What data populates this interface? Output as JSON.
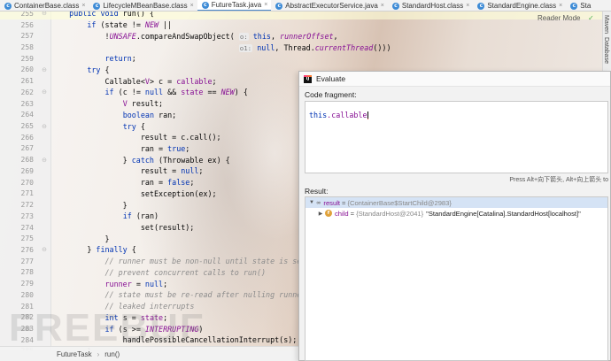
{
  "tabs": [
    {
      "label": "ContainerBase.class",
      "icon": "class-icon",
      "active": false
    },
    {
      "label": "LifecycleMBeanBase.class",
      "icon": "class-icon",
      "active": false
    },
    {
      "label": "FutureTask.java",
      "icon": "java-class-icon",
      "active": true
    },
    {
      "label": "AbstractExecutorService.java",
      "icon": "java-class-icon",
      "active": false
    },
    {
      "label": "StandardHost.class",
      "icon": "class-icon",
      "active": false
    },
    {
      "label": "StandardEngine.class",
      "icon": "class-icon",
      "active": false
    },
    {
      "label": "Sta",
      "icon": "class-icon",
      "active": false
    }
  ],
  "editor": {
    "reader_mode": "Reader Mode",
    "lines": [
      {
        "num": "255",
        "html": "    <span class=\"kw\">public void</span> run() {"
      },
      {
        "num": "256",
        "html": "        <span class=\"kw\">if</span> (state != <span class=\"it\">NEW</span> ||"
      },
      {
        "num": "257",
        "html": "            !<span class=\"it\">UNSAFE</span>.compareAndSwapObject( <span class=\"hint\">o:</span> <span class=\"kw\">this</span>, <span class=\"it\">runnerOffset</span>,"
      },
      {
        "num": "258",
        "html": "                                          <span class=\"hint\">o1:</span> <span class=\"kw\">null</span>, Thread.<span class=\"it\">currentThread</span>()))"
      },
      {
        "num": "259",
        "html": "            <span class=\"kw\">return</span>;"
      },
      {
        "num": "260",
        "html": "        <span class=\"kw\">try</span> {"
      },
      {
        "num": "261",
        "html": "            Callable&lt;<span class=\"fld\">V</span>&gt; c = <span class=\"fld\">callable</span>;"
      },
      {
        "num": "262",
        "html": "            <span class=\"kw\">if</span> (c != <span class=\"kw\">null</span> &amp;&amp; <span class=\"fld\">state</span> == <span class=\"it\">NEW</span>) {"
      },
      {
        "num": "263",
        "html": "                <span class=\"fld\">V</span> result;"
      },
      {
        "num": "264",
        "html": "                <span class=\"kw\">boolean</span> ran;"
      },
      {
        "num": "265",
        "html": "                <span class=\"kw\">try</span> {"
      },
      {
        "num": "266",
        "html": "                    result = c.call();"
      },
      {
        "num": "267",
        "html": "                    ran = <span class=\"kw\">true</span>;"
      },
      {
        "num": "268",
        "html": "                } <span class=\"kw\">catch</span> (Throwable ex) {"
      },
      {
        "num": "269",
        "html": "                    result = <span class=\"kw\">null</span>;"
      },
      {
        "num": "270",
        "html": "                    ran = <span class=\"kw\">false</span>;"
      },
      {
        "num": "271",
        "html": "                    setException(ex);"
      },
      {
        "num": "272",
        "html": "                }"
      },
      {
        "num": "273",
        "html": "                <span class=\"kw\">if</span> (ran)"
      },
      {
        "num": "274",
        "html": "                    set(result);"
      },
      {
        "num": "275",
        "html": "            }"
      },
      {
        "num": "276",
        "html": "        } <span class=\"kw\">finally</span> {"
      },
      {
        "num": "277",
        "html": "            <span class=\"cm\">// runner must be non-null until state is sett</span>"
      },
      {
        "num": "278",
        "html": "            <span class=\"cm\">// prevent concurrent calls to run()</span>"
      },
      {
        "num": "279",
        "html": "            <span class=\"fld\">runner</span> = <span class=\"kw\">null</span>;"
      },
      {
        "num": "280",
        "html": "            <span class=\"cm\">// state must be re-read after nulling runner</span>"
      },
      {
        "num": "281",
        "html": "            <span class=\"cm\">// leaked interrupts</span>"
      },
      {
        "num": "282",
        "html": "            <span class=\"kw\">int</span> s = <span class=\"fld\">state</span>;"
      },
      {
        "num": "283",
        "html": "            <span class=\"kw\">if</span> (s &gt;= <span class=\"it\">INTERRUPTING</span>)"
      },
      {
        "num": "284",
        "html": "                handlePossibleCancellationInterrupt(s);"
      },
      {
        "num": "285",
        "html": "        }"
      }
    ]
  },
  "statusbar": {
    "breadcrumb": [
      "FutureTask",
      "run()"
    ]
  },
  "watermark": "FREEBUF",
  "tool_strip": [
    "Maven",
    "Database"
  ],
  "dialog": {
    "title": "Evaluate",
    "fragment_label": "Code fragment:",
    "fragment_this": "this",
    "fragment_rest": ".callable",
    "shortcut_hint": "Press Alt+向下箭头, Alt+向上箭头 to",
    "result_label": "Result:",
    "result": {
      "name": "result",
      "type": "{ContainerBase$StartChild@2983}",
      "children": [
        {
          "name": "child",
          "type": "{StandardHost@2041}",
          "value": "\"StandardEngine[Catalina].StandardHost[localhost]\""
        }
      ]
    }
  }
}
